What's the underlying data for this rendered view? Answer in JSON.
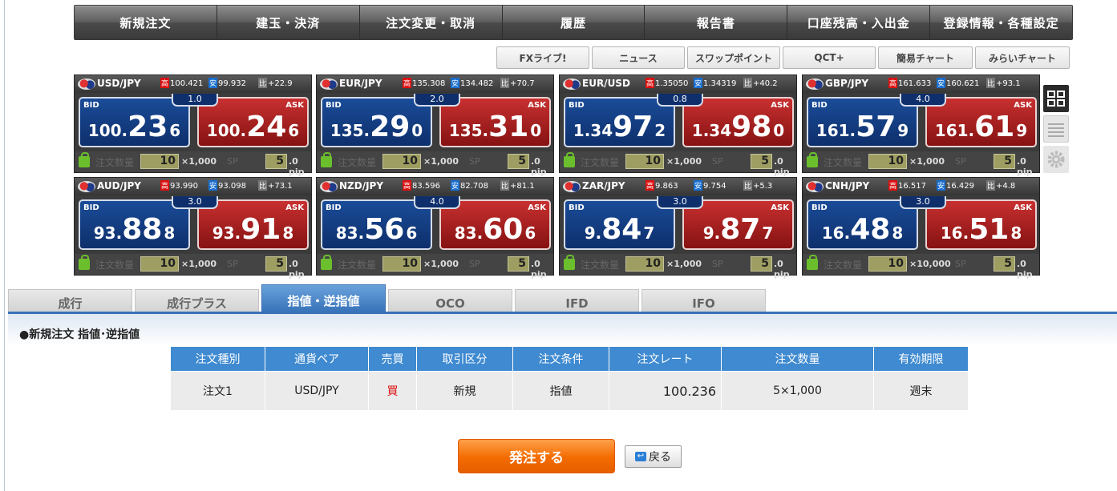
{
  "nav": [
    "新規注文",
    "建玉・決済",
    "注文変更・取消",
    "履歴",
    "報告書",
    "口座残高・入出金",
    "登録情報・各種設定"
  ],
  "subnav": [
    "FXライブ!",
    "ニュース",
    "スワップポイント",
    "QCT+",
    "簡易チャート",
    "みらいチャート"
  ],
  "labels": {
    "bid": "BID",
    "ask": "ASK",
    "qty": "注文数量",
    "sp": "SP",
    "pip": ".0 pip",
    "hi": "高",
    "lo": "安",
    "diff": "比"
  },
  "panels": [
    {
      "pair": "USD/JPY",
      "high": "100.421",
      "low": "99.932",
      "change": "+22.9",
      "spread": "1.0",
      "bid": {
        "a": "100.",
        "b": "23",
        "c": "6"
      },
      "ask": {
        "a": "100.",
        "b": "24",
        "c": "6"
      },
      "qty": "10",
      "unit": "×1,000",
      "sp": "5"
    },
    {
      "pair": "EUR/JPY",
      "high": "135.308",
      "low": "134.482",
      "change": "+70.7",
      "spread": "2.0",
      "bid": {
        "a": "135.",
        "b": "29",
        "c": "0"
      },
      "ask": {
        "a": "135.",
        "b": "31",
        "c": "0"
      },
      "qty": "10",
      "unit": "×1,000",
      "sp": "5"
    },
    {
      "pair": "EUR/USD",
      "high": "1.35050",
      "low": "1.34319",
      "change": "+40.2",
      "spread": "0.8",
      "bid": {
        "a": "1.34",
        "b": "97",
        "c": "2"
      },
      "ask": {
        "a": "1.34",
        "b": "98",
        "c": "0"
      },
      "qty": "10",
      "unit": "×1,000",
      "sp": "5"
    },
    {
      "pair": "GBP/JPY",
      "high": "161.633",
      "low": "160.621",
      "change": "+93.1",
      "spread": "4.0",
      "bid": {
        "a": "161.",
        "b": "57",
        "c": "9"
      },
      "ask": {
        "a": "161.",
        "b": "61",
        "c": "9"
      },
      "qty": "10",
      "unit": "×1,000",
      "sp": "5"
    },
    {
      "pair": "AUD/JPY",
      "high": "93.990",
      "low": "93.098",
      "change": "+73.1",
      "spread": "3.0",
      "bid": {
        "a": "93.",
        "b": "88",
        "c": "8"
      },
      "ask": {
        "a": "93.",
        "b": "91",
        "c": "8"
      },
      "qty": "10",
      "unit": "×1,000",
      "sp": "5"
    },
    {
      "pair": "NZD/JPY",
      "high": "83.596",
      "low": "82.708",
      "change": "+81.1",
      "spread": "4.0",
      "bid": {
        "a": "83.",
        "b": "56",
        "c": "6"
      },
      "ask": {
        "a": "83.",
        "b": "60",
        "c": "6"
      },
      "qty": "10",
      "unit": "×1,000",
      "sp": "5"
    },
    {
      "pair": "ZAR/JPY",
      "high": "9.863",
      "low": "9.754",
      "change": "+5.3",
      "spread": "3.0",
      "bid": {
        "a": "9.",
        "b": "84",
        "c": "7"
      },
      "ask": {
        "a": "9.",
        "b": "87",
        "c": "7"
      },
      "qty": "10",
      "unit": "×1,000",
      "sp": "5"
    },
    {
      "pair": "CNH/JPY",
      "high": "16.517",
      "low": "16.429",
      "change": "+4.8",
      "spread": "3.0",
      "bid": {
        "a": "16.",
        "b": "48",
        "c": "8"
      },
      "ask": {
        "a": "16.",
        "b": "51",
        "c": "8"
      },
      "qty": "10",
      "unit": "×10,000",
      "sp": "5"
    }
  ],
  "tabs": [
    "成行",
    "成行プラス",
    "指値・逆指値",
    "OCO",
    "IFD",
    "IFO"
  ],
  "active_tab": "指値・逆指値",
  "section_title": "●新規注文 指値･逆指値",
  "table": {
    "headers": [
      "注文種別",
      "通貨ペア",
      "売買",
      "取引区分",
      "注文条件",
      "注文レート",
      "注文数量",
      "有効期限"
    ],
    "row": [
      "注文1",
      "USD/JPY",
      "買",
      "新規",
      "指値",
      "100.236",
      "5×1,000",
      "週末"
    ]
  },
  "order_button": "発注する",
  "back_button": "戻る"
}
